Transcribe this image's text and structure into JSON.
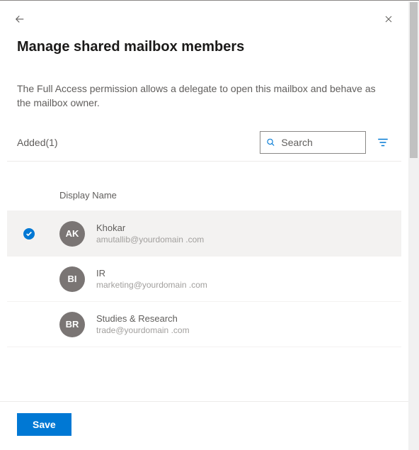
{
  "header": {
    "title": "Manage shared mailbox members"
  },
  "description": "The Full Access permission allows a delegate to open this mailbox and behave as the mailbox owner.",
  "added_label": "Added(1)",
  "search": {
    "placeholder": "Search"
  },
  "list": {
    "column_header": "Display Name",
    "rows": [
      {
        "initials": "AK",
        "name": "Khokar",
        "email": "amutallib@yourdomain .com",
        "selected": true
      },
      {
        "initials": "BI",
        "name": "IR",
        "email": "marketing@yourdomain .com",
        "selected": false
      },
      {
        "initials": "BR",
        "name": "Studies & Research",
        "email": "trade@yourdomain .com",
        "selected": false
      }
    ]
  },
  "footer": {
    "save_label": "Save"
  }
}
